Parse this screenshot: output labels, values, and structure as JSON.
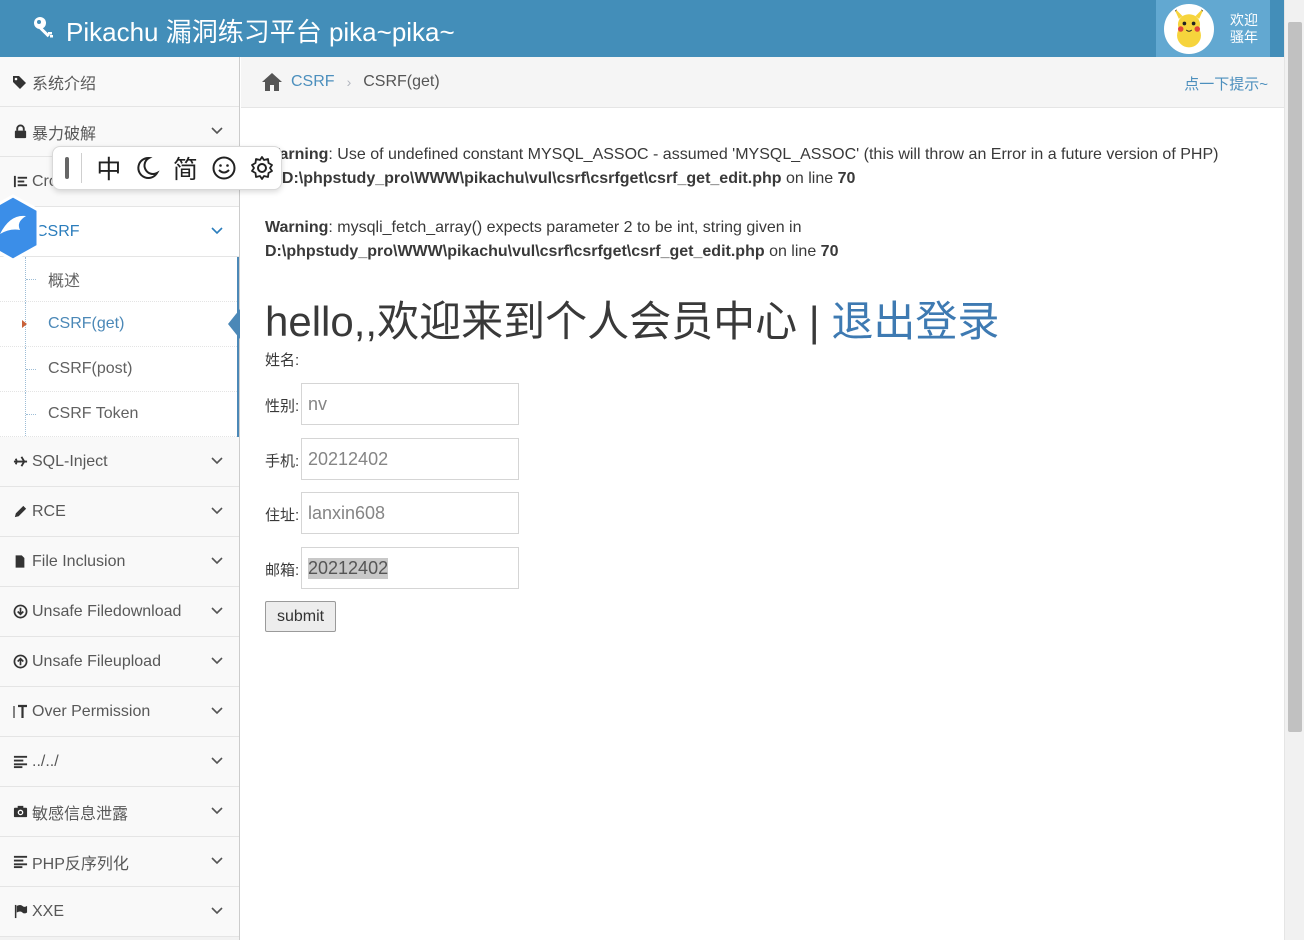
{
  "navbar": {
    "title": "Pikachu 漏洞练习平台 pika~pika~",
    "user_greeting_line1": "欢迎",
    "user_greeting_line2": "骚年"
  },
  "sidebar": {
    "items": [
      {
        "label": "系统介绍",
        "icon": "tags-icon"
      },
      {
        "label": "暴力破解",
        "icon": "lock-icon"
      },
      {
        "label": "Cross-Site Scripting",
        "visible_text": "Cro",
        "icon": "list-icon"
      },
      {
        "label": "CSRF",
        "icon": "csrf-icon"
      },
      {
        "label": "SQL-Inject",
        "icon": "plane-icon"
      },
      {
        "label": "RCE",
        "icon": "pencil-icon"
      },
      {
        "label": "File Inclusion",
        "icon": "file-icon"
      },
      {
        "label": "Unsafe Filedownload",
        "icon": "download-circle-icon"
      },
      {
        "label": "Unsafe Fileupload",
        "icon": "upload-circle-icon"
      },
      {
        "label": "Over Permission",
        "icon": "text-height-icon"
      },
      {
        "label": "../../",
        "icon": "align-left-icon"
      },
      {
        "label": "敏感信息泄露",
        "icon": "camera-icon"
      },
      {
        "label": "PHP反序列化",
        "icon": "align-left-icon"
      },
      {
        "label": "XXE",
        "icon": "flag-icon"
      }
    ],
    "csrf_sub": [
      {
        "label": "概述"
      },
      {
        "label": "CSRF(get)"
      },
      {
        "label": "CSRF(post)"
      },
      {
        "label": "CSRF Token"
      }
    ]
  },
  "breadcrumb": {
    "link": "CSRF",
    "separator": "›",
    "current": "CSRF(get)",
    "hint": "点一下提示~"
  },
  "warnings": [
    {
      "label": "Warning",
      "line1_rest": ": Use of undefined constant MYSQL_ASSOC - assumed 'MYSQL_ASSOC' (this will throw an Error in a future version of PHP)",
      "in_word": "in",
      "path": "D:\\phpstudy_pro\\WWW\\pikachu\\vul\\csrf\\csrfget\\csrf_get_edit.php",
      "on_line": "on line",
      "line_no": "70"
    },
    {
      "label": "Warning",
      "line1_rest": ": mysqli_fetch_array() expects parameter 2 to be int, string given in",
      "path": "D:\\phpstudy_pro\\WWW\\pikachu\\vul\\csrf\\csrfget\\csrf_get_edit.php",
      "on_line": "on line",
      "line_no": "70"
    }
  ],
  "main": {
    "hello": "hello,,欢迎来到个人会员中心 | ",
    "logout": "退出登录",
    "name_label": "姓名:",
    "gender_label": "性别:",
    "gender_value": "nv",
    "phone_label": "手机:",
    "phone_value": "20212402",
    "address_label": "住址:",
    "address_value": "lanxin608",
    "email_label": "邮箱:",
    "email_value": "20212402",
    "submit_label": "submit"
  },
  "ime": {
    "chinese": "中",
    "simplified": "简"
  },
  "colors": {
    "navbar": "#438eb9",
    "link": "#4c8fbd",
    "active": "#2b7dbc"
  }
}
